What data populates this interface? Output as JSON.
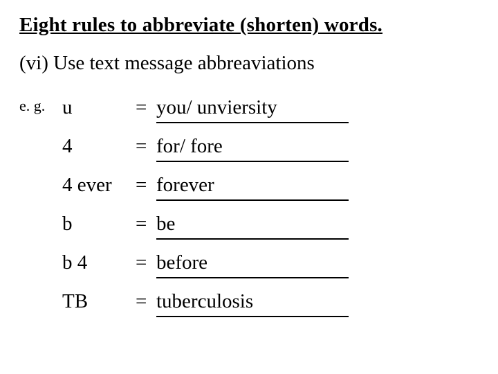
{
  "title": "Eight rules to abbreviate (shorten) words.",
  "subtitle": "(vi) Use text message abbreaviations",
  "eg_label": "e. g.",
  "equals": "=",
  "rows": [
    {
      "abbr": "u",
      "answer": "you/ unviersity"
    },
    {
      "abbr": "4",
      "answer": "for/ fore"
    },
    {
      "abbr": "4 ever",
      "answer": "forever"
    },
    {
      "abbr": "b",
      "answer": "be"
    },
    {
      "abbr": "b 4",
      "answer": "before"
    },
    {
      "abbr": "TB",
      "answer": "tuberculosis"
    }
  ]
}
